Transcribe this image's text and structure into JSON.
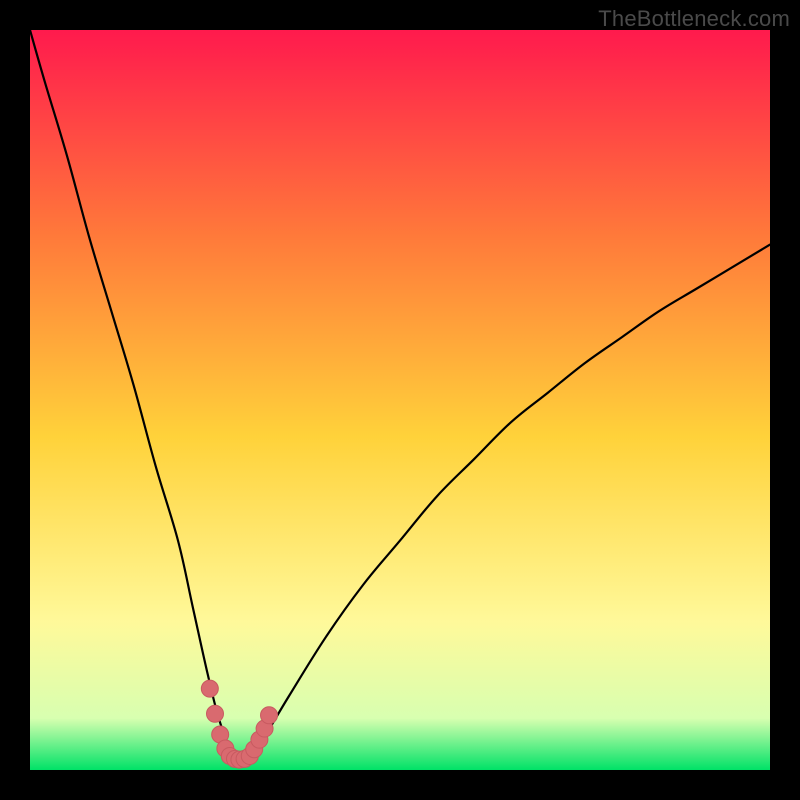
{
  "watermark": "TheBottleneck.com",
  "colors": {
    "frame": "#000000",
    "grad_top": "#ff1a4d",
    "grad_mid_upper": "#ff7a3a",
    "grad_mid": "#ffd23a",
    "grad_lower": "#fff99a",
    "grad_near_bottom": "#d8ffb0",
    "grad_bottom": "#00e267",
    "curve": "#000000",
    "marker_fill": "#d96a6f",
    "marker_outline": "#c85a60"
  },
  "chart_data": {
    "type": "line",
    "title": "",
    "xlabel": "",
    "ylabel": "",
    "xlim": [
      0,
      100
    ],
    "ylim": [
      0,
      100
    ],
    "note": "Values estimated from pixels; chart has no visible axis ticks/labels. y ≈ bottleneck % (0 at bottom, ~100 at top). x ≈ normalized horizontal position.",
    "series": [
      {
        "name": "bottleneck-curve",
        "x": [
          0,
          2,
          5,
          8,
          11,
          14,
          17,
          20,
          22,
          24,
          25.5,
          27,
          28,
          28.8,
          30,
          32,
          35,
          40,
          45,
          50,
          55,
          60,
          65,
          70,
          75,
          80,
          85,
          90,
          95,
          100
        ],
        "y": [
          100,
          93,
          83,
          72,
          62,
          52,
          41,
          31,
          22,
          13,
          7,
          3,
          1.5,
          1.4,
          2,
          5,
          10,
          18,
          25,
          31,
          37,
          42,
          47,
          51,
          55,
          58.5,
          62,
          65,
          68,
          71
        ]
      }
    ],
    "markers": {
      "name": "optimal-range",
      "x": [
        24.3,
        25.0,
        25.7,
        26.4,
        27.0,
        27.7,
        28.3,
        29.0,
        29.7,
        30.3,
        31.0,
        31.7,
        32.3
      ],
      "y": [
        11.0,
        7.6,
        4.8,
        2.9,
        1.9,
        1.5,
        1.4,
        1.5,
        1.9,
        2.8,
        4.1,
        5.6,
        7.4
      ]
    }
  }
}
